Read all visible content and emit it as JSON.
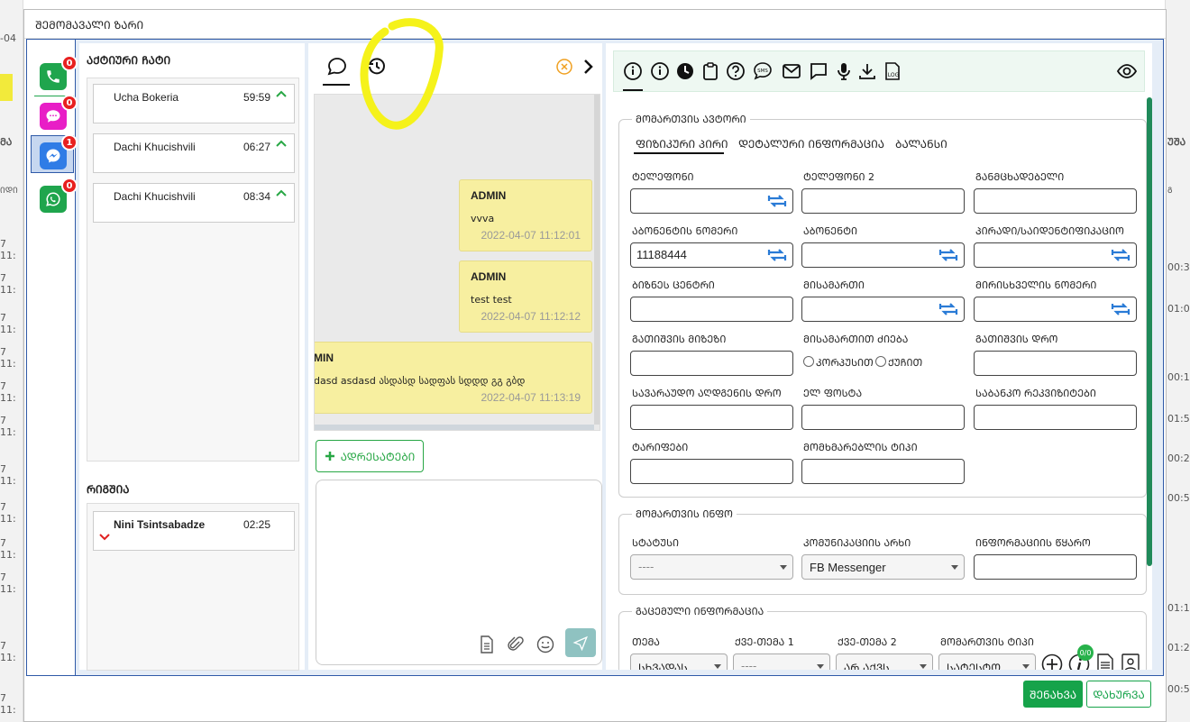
{
  "background": {
    "left_cells": [
      "-04",
      "ᲛᲐ",
      "ᲘᲓᲘ",
      "7 11:",
      "7 11:",
      "7 11:",
      "7 11:",
      "7 11:",
      "7 11:",
      "7 11:",
      "7 11:",
      "7 11:",
      "7 11:",
      "7 11:",
      "7 11:"
    ],
    "right_cells": [
      "ᲣᲨᲐ",
      "Გ",
      "00:34",
      "01:00",
      "00:13",
      "01:51",
      "00:26",
      "00:53",
      "01:15",
      "01:26",
      "00:56"
    ]
  },
  "dialog": {
    "title": "ᲨᲔᲛᲝᲛᲐᲕᲐᲚᲘ ᲖᲐᲠᲘ",
    "save_label": "ᲨᲔᲜᲐᲮᲕᲐ",
    "close_label": "ᲓᲐᲮᲣᲠᲕᲐ"
  },
  "channels": [
    {
      "name": "phone",
      "badge": "0",
      "color": "#1fa54d",
      "icon": "phone-icon"
    },
    {
      "name": "chat",
      "badge": "0",
      "color": "#e81ec6",
      "icon": "chat-bubble-icon"
    },
    {
      "name": "messenger",
      "badge": "1",
      "color": "#2f7ce6",
      "icon": "messenger-icon"
    },
    {
      "name": "whatsapp",
      "badge": "0",
      "color": "#1fa54d",
      "icon": "whatsapp-icon"
    }
  ],
  "active_chats": {
    "title": "ᲐᲥᲢᲘᲣᲠᲘ ᲩᲐᲢᲘ",
    "items": [
      {
        "name": "Ucha Bokeria",
        "time": "59:59"
      },
      {
        "name": "Dachi Khucishvili",
        "time": "06:27"
      },
      {
        "name": "Dachi Khucishvili",
        "time": "08:34"
      }
    ]
  },
  "queue": {
    "title": "ᲠᲘᲒᲨᲘᲐ",
    "items": [
      {
        "name": "Nini Tsintsabadze",
        "time": "02:25"
      }
    ]
  },
  "conversation": {
    "messages": [
      {
        "user": "ADMIN",
        "text": "vvva",
        "date": "2022-04-07 11:12:01"
      },
      {
        "user": "ADMIN",
        "text": "test   test",
        "date": "2022-04-07 11:12:12"
      },
      {
        "user": "MIN",
        "text": "dasd   asdasd ასდასდ სადფას    სდდდ  გგ   გბდ",
        "date": "2022-04-07 11:13:19"
      }
    ],
    "add_button": "ᲐᲓᲠᲔᲡᲐᲢᲔᲑᲘ"
  },
  "info": {
    "author_section": "ᲛᲝᲛᲐᲠᲗᲕᲘᲡ ᲐᲕᲢᲝᲠᲘ",
    "subtabs": [
      "ᲤᲘᲖᲘᲙᲣᲠᲘ ᲞᲘᲠᲘ",
      "ᲓᲔᲢᲐᲚᲣᲠᲘ ᲘᲜᲤᲝᲠᲛᲐᲪᲘᲐ",
      "ᲑᲐᲚᲐᲜᲡᲘ"
    ],
    "fields": [
      {
        "label": "ᲢᲔᲚᲔᲤᲝᲜᲘ",
        "value": ""
      },
      {
        "label": "ᲢᲔᲚᲔᲤᲝᲜᲘ 2",
        "value": ""
      },
      {
        "label": "ᲒᲐᲜᲛᲪᲮᲐᲓᲔᲑᲔᲚᲘ",
        "value": ""
      },
      {
        "label": "ᲐᲑᲝᲜᲔᲜᲢᲘᲡ ᲜᲝᲛᲔᲠᲘ",
        "value": "11188444"
      },
      {
        "label": "ᲐᲑᲝᲜᲔᲜᲢᲘ",
        "value": ""
      },
      {
        "label": "ᲞᲘᲠᲐᲓᲘ/ᲡᲐᲘᲓᲔᲜᲢᲘᲤᲘᲙᲐᲪᲘᲝ",
        "value": ""
      },
      {
        "label": "ᲑᲘᲖᲜᲔᲡ ᲪᲔᲜᲢᲠᲘ",
        "value": ""
      },
      {
        "label": "ᲛᲘᲡᲐᲛᲐᲠᲗᲘ",
        "value": ""
      },
      {
        "label": "ᲛᲘᲠᲘᲡᲮᲕᲔᲚᲘᲡ ᲜᲝᲛᲔᲠᲘ",
        "value": ""
      },
      {
        "label": "ᲒᲐᲗᲘᲨᲕᲘᲡ ᲛᲘᲖᲔᲖᲘ",
        "value": ""
      },
      {
        "label": "ᲛᲘᲡᲐᲛᲐᲠᲗᲘᲗ ᲫᲘᲔᲑᲐ",
        "value": ""
      },
      {
        "label": "ᲒᲐᲗᲘᲨᲕᲘᲡ ᲓᲠᲝ",
        "value": ""
      },
      {
        "label": "ᲡᲐᲕᲐᲠᲐᲣᲓᲝ ᲐᲦᲓᲒᲔᲜᲘᲡ ᲓᲠᲝ",
        "value": ""
      },
      {
        "label": "ᲔᲚ ᲤᲝᲡᲢᲐ",
        "value": ""
      },
      {
        "label": "ᲡᲐᲑᲐᲜᲙᲝ ᲠᲔᲙᲕᲘᲖᲘᲢᲔᲑᲘ",
        "value": ""
      },
      {
        "label": "ᲢᲐᲠᲘᲤᲔᲑᲘ",
        "value": ""
      },
      {
        "label": "ᲛᲝᲛᲮᲛᲐᲠᲔᲑᲚᲘᲡ ᲢᲘᲞᲘ",
        "value": ""
      }
    ],
    "radio_options": [
      "ᲙᲝᲠᲞᲣᲡᲘᲗ",
      "ᲥᲣᲩᲘᲗ"
    ],
    "request_section": "ᲛᲝᲛᲐᲠᲗᲕᲘᲡ ᲘᲜᲤᲝ",
    "status_label": "ᲡᲢᲐᲢᲣᲡᲘ",
    "status_value": "----",
    "channel_label": "ᲙᲝᲛᲣᲜᲘᲙᲐᲪᲘᲘᲡ ᲐᲠᲮᲘ",
    "channel_value": "FB Messenger",
    "source_label": "ᲘᲜᲤᲝᲠᲛᲐᲪᲘᲘᲡ ᲬᲧᲐᲠᲝ",
    "given_section": "ᲒᲐᲪᲔᲛᲣᲚᲘ ᲘᲜᲤᲝᲠᲛᲐᲪᲘᲐ",
    "topic_label": "ᲗᲔᲛᲐ",
    "topic_value": "ᲡᲮᲕᲐᲓᲐᲡ...",
    "subtopic1_label": "ᲥᲕᲔ-ᲗᲔᲛᲐ 1",
    "subtopic1_value": "----",
    "subtopic2_label": "ᲥᲕᲔ-ᲗᲔᲛᲐ 2",
    "subtopic2_value": "ᲐᲠ ᲐᲥᲕᲡ ...",
    "request_type_label": "ᲛᲝᲛᲐᲠᲗᲕᲘᲡ ᲢᲘᲞᲘ",
    "request_type_value": "ᲡᲐᲢᲔᲡᲢᲝ",
    "info_badge": "0/0"
  }
}
